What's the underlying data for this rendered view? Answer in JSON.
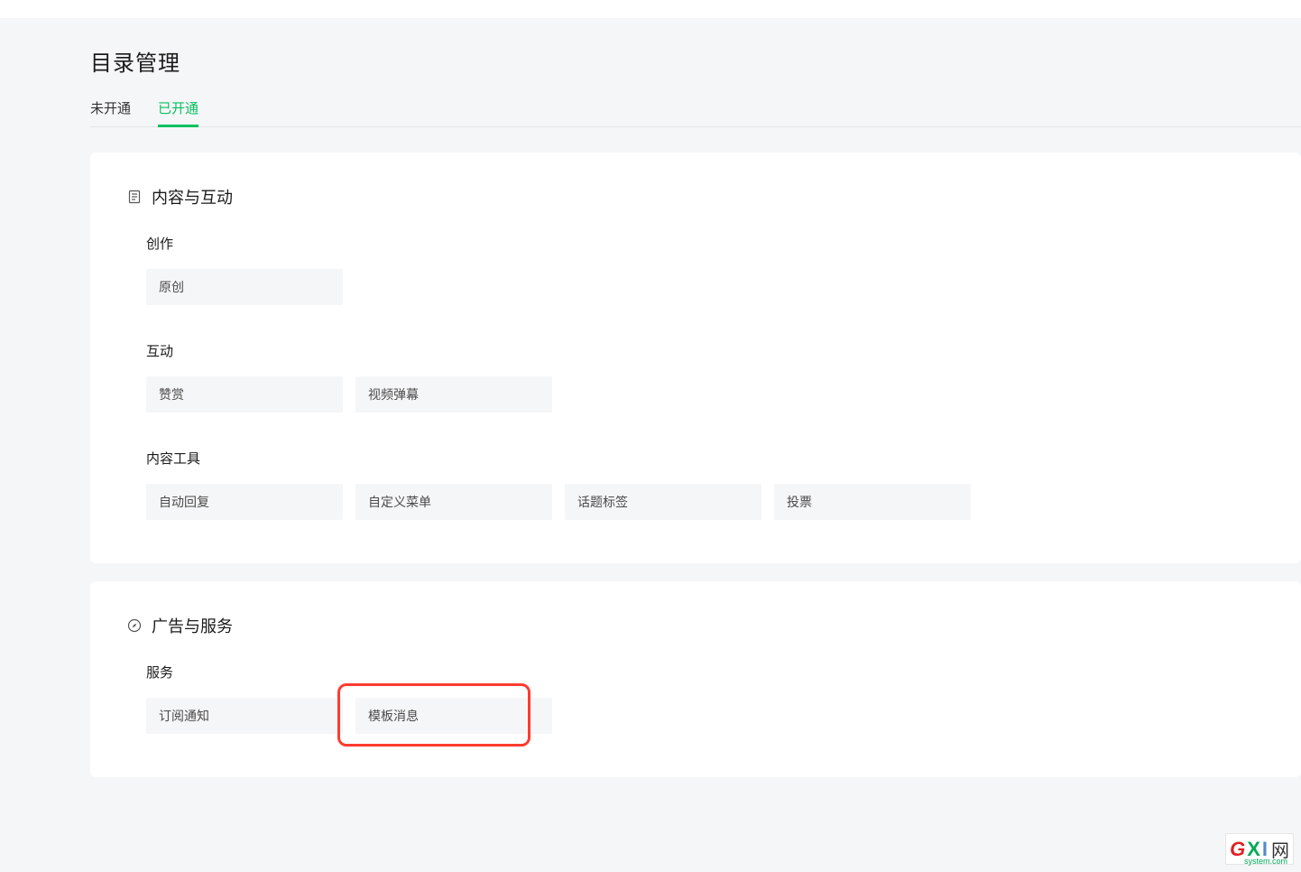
{
  "page": {
    "title": "目录管理"
  },
  "tabs": [
    {
      "label": "未开通",
      "active": false
    },
    {
      "label": "已开通",
      "active": true
    }
  ],
  "sections": [
    {
      "icon": "document-icon",
      "title": "内容与互动",
      "subsections": [
        {
          "label": "创作",
          "items": [
            "原创"
          ]
        },
        {
          "label": "互动",
          "items": [
            "赞赏",
            "视频弹幕"
          ]
        },
        {
          "label": "内容工具",
          "items": [
            "自动回复",
            "自定义菜单",
            "话题标签",
            "投票"
          ]
        }
      ]
    },
    {
      "icon": "compass-icon",
      "title": "广告与服务",
      "subsections": [
        {
          "label": "服务",
          "items": [
            "订阅通知",
            "模板消息"
          ]
        }
      ]
    }
  ],
  "highlight": {
    "section_index": 1,
    "subsection_index": 0,
    "item_index": 1
  },
  "watermark": {
    "g": "G",
    "x": "X",
    "i": "I",
    "cn": "网",
    "sub": "system.com"
  }
}
